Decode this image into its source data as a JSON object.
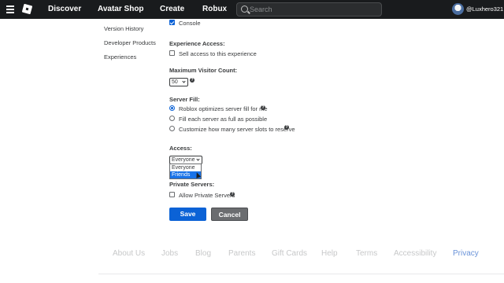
{
  "topbar": {
    "nav": [
      "Discover",
      "Avatar Shop",
      "Create",
      "Robux"
    ],
    "search_placeholder": "Search",
    "username": "@Luxhero321"
  },
  "sidebar": {
    "items": [
      {
        "label": "Version History"
      },
      {
        "label": "Developer Products"
      },
      {
        "label": "Experiences"
      }
    ]
  },
  "form": {
    "console_label": "Console",
    "experience_access": {
      "heading": "Experience Access:",
      "sell_label": "Sell access to this experience"
    },
    "max_visitors": {
      "heading": "Maximum Visitor Count:",
      "value": "50"
    },
    "server_fill": {
      "heading": "Server Fill:",
      "options": [
        "Roblox optimizes server fill for me",
        "Fill each server as full as possible",
        "Customize how many server slots to reserve"
      ]
    },
    "access": {
      "heading": "Access:",
      "selected": "Everyone",
      "options": [
        "Everyone",
        "Friends"
      ]
    },
    "private_servers": {
      "heading": "Private Servers:",
      "allow_label": "Allow Private Servers"
    },
    "save_label": "Save",
    "cancel_label": "Cancel"
  },
  "footer": {
    "links": [
      "About Us",
      "Jobs",
      "Blog",
      "Parents",
      "Gift Cards",
      "Help",
      "Terms",
      "Accessibility",
      "Privacy"
    ]
  }
}
